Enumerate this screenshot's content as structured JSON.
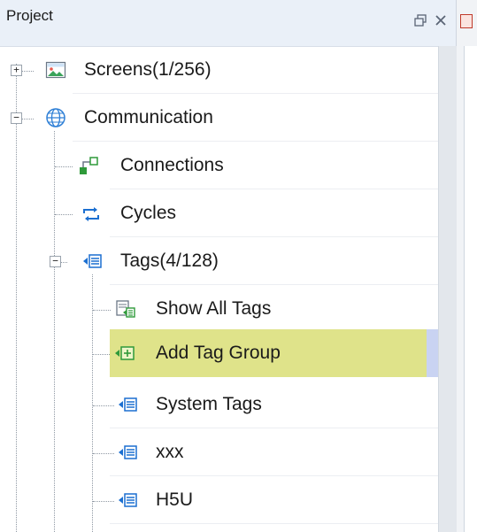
{
  "panel": {
    "title": "Project"
  },
  "header_buttons": {
    "float_icon": "float-window-icon",
    "close_icon": "close-icon"
  },
  "tree": {
    "items": [
      {
        "label": "Screens(1/256)",
        "icon": "screen-image-icon",
        "expander": "+"
      },
      {
        "label": "Communication",
        "icon": "globe-icon",
        "expander": "−"
      },
      {
        "label": "Connections",
        "icon": "connection-icon"
      },
      {
        "label": "Cycles",
        "icon": "cycle-arrows-icon"
      },
      {
        "label": "Tags(4/128)",
        "icon": "tag-list-icon",
        "expander": "−"
      },
      {
        "label": "Show All Tags",
        "icon": "show-tags-icon"
      },
      {
        "label": "Add Tag Group",
        "icon": "add-tag-group-icon",
        "selected": true
      },
      {
        "label": "System Tags",
        "icon": "tag-list-icon"
      },
      {
        "label": "xxx",
        "icon": "tag-list-icon"
      },
      {
        "label": "H5U",
        "icon": "tag-list-icon"
      }
    ]
  },
  "colors": {
    "header_bg": "#eaf0f8",
    "selection": "#dfe38a",
    "selection_accent": "#c9d3f2",
    "tag_icon_blue": "#1b6fd1",
    "connection_green": "#2f9a3a"
  }
}
